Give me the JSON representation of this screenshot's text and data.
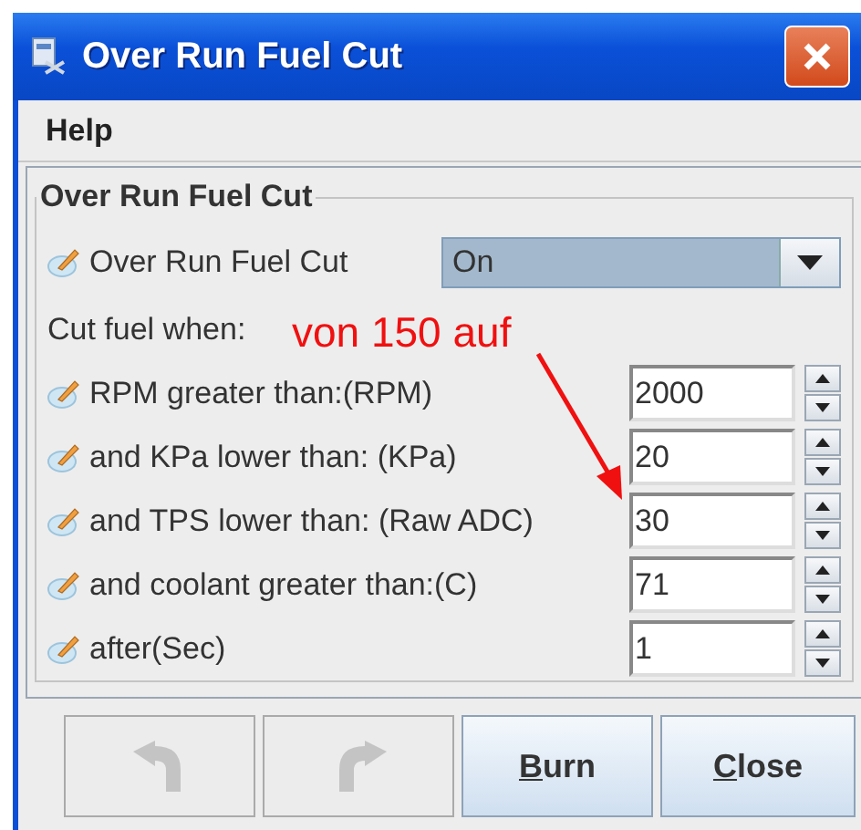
{
  "window": {
    "title": "Over Run Fuel Cut"
  },
  "menu": [
    "Help"
  ],
  "panel": {
    "title": "Over Run Fuel Cut",
    "toggle": {
      "label": "Over Run Fuel Cut",
      "value": "On"
    },
    "section_label": "Cut fuel when:",
    "fields": [
      {
        "label": "RPM greater than:(RPM)",
        "value": "2000"
      },
      {
        "label": "and KPa lower than:  (KPa)",
        "value": "20"
      },
      {
        "label": "and TPS lower than:  (Raw ADC)",
        "value": "30"
      },
      {
        "label": "and coolant greater than:(C)",
        "value": "71"
      },
      {
        "label": "after(Sec)",
        "value": "1"
      }
    ]
  },
  "annotation": {
    "text": "von 150 auf"
  },
  "buttons": [
    {
      "kind": "undo",
      "disabled": true
    },
    {
      "kind": "redo",
      "disabled": true
    },
    {
      "kind": "text",
      "label": "Burn",
      "disabled": false
    },
    {
      "kind": "text",
      "label": "Close",
      "disabled": false
    }
  ]
}
